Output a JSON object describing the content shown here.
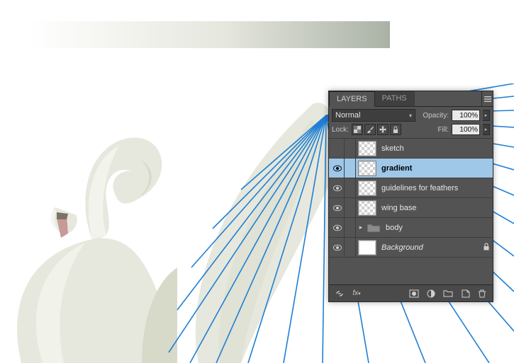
{
  "panel": {
    "tabs": {
      "layers": "LAYERS",
      "paths": "PATHS"
    },
    "blend_mode": "Normal",
    "opacity_label": "Opacity:",
    "opacity_value": "100%",
    "lock_label": "Lock:",
    "fill_label": "Fill:",
    "fill_value": "100%"
  },
  "layers": [
    {
      "name": "sketch",
      "visible": false,
      "selected": false,
      "type": "pixel",
      "italic": false,
      "locked": false
    },
    {
      "name": "gradient",
      "visible": true,
      "selected": true,
      "type": "pixel",
      "italic": false,
      "locked": false
    },
    {
      "name": "guidelines for feathers",
      "visible": true,
      "selected": false,
      "type": "pixel",
      "italic": false,
      "locked": false
    },
    {
      "name": "wing base",
      "visible": true,
      "selected": false,
      "type": "pixel",
      "italic": false,
      "locked": false
    },
    {
      "name": "body",
      "visible": true,
      "selected": false,
      "type": "group",
      "italic": false,
      "locked": false
    },
    {
      "name": "Background",
      "visible": true,
      "selected": false,
      "type": "bg",
      "italic": true,
      "locked": true
    }
  ],
  "lock_buttons": [
    "transparent-pixels",
    "image-pixels",
    "position",
    "all"
  ],
  "footer_buttons": {
    "link": "link-layers-button",
    "fx": "layer-style-button",
    "mask": "add-mask-button",
    "adjust": "adjustment-layer-button",
    "group": "new-group-button",
    "new": "new-layer-button",
    "trash": "delete-layer-button"
  },
  "art": {
    "gradient_start": "#ffffff",
    "gradient_end": "#aab2a6",
    "swan_body": "#e6e8dd",
    "swan_shadow": "#cfd3c5",
    "swan_light": "#f4f5ef",
    "beak": "#c79a98",
    "guideline": "#1f7fd6"
  }
}
